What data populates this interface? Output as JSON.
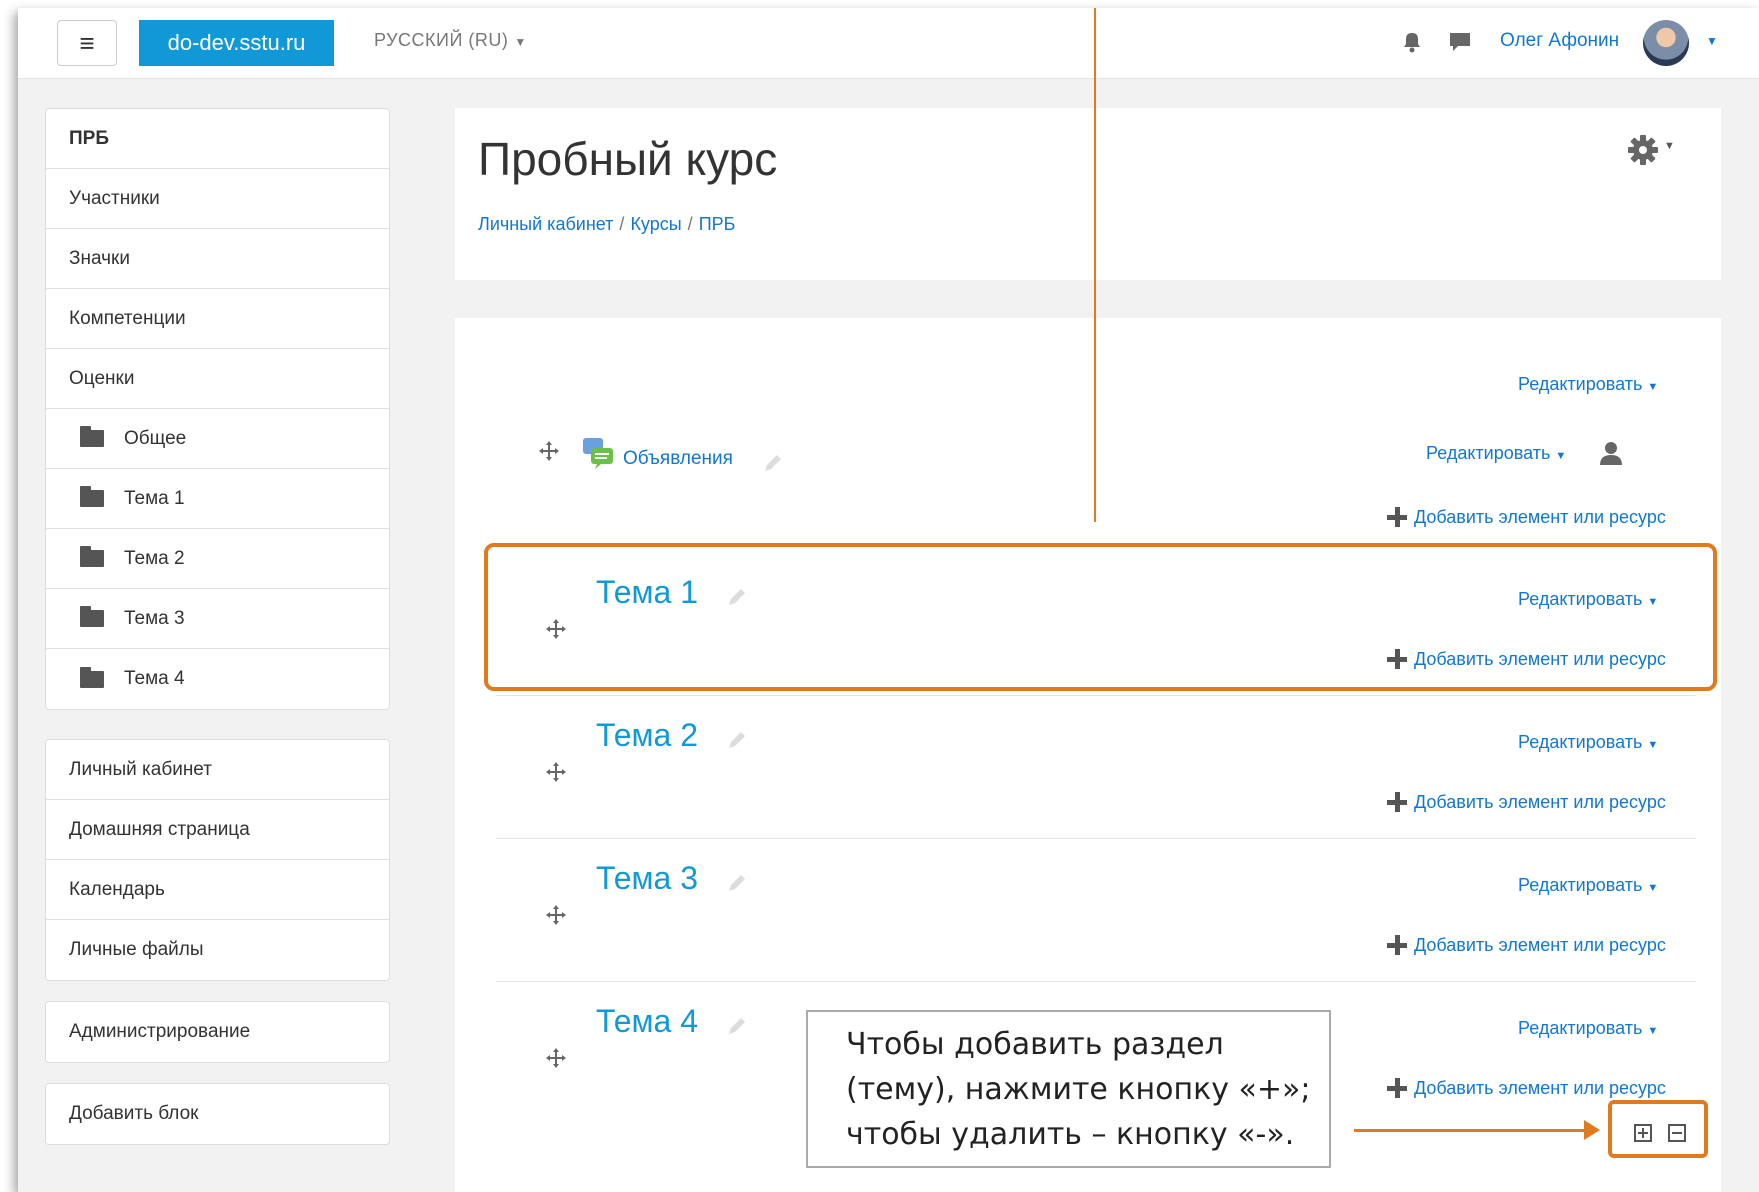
{
  "navbar": {
    "menu_icon": "hamburger-icon",
    "brand": "do-dev.sstu.ru",
    "language": "РУССКИЙ (RU)",
    "user_name": "Олег Афонин",
    "icons": [
      "bell-icon",
      "chat-icon",
      "avatar"
    ]
  },
  "sidebar": {
    "nav": [
      {
        "label": "ПРБ"
      },
      {
        "label": "Участники"
      },
      {
        "label": "Значки"
      },
      {
        "label": "Компетенции"
      },
      {
        "label": "Оценки"
      },
      {
        "label": "Общее"
      },
      {
        "label": "Тема 1"
      },
      {
        "label": "Тема 2"
      },
      {
        "label": "Тема 3"
      },
      {
        "label": "Тема 4"
      }
    ],
    "links": [
      {
        "label": "Личный кабинет"
      },
      {
        "label": "Домашняя страница"
      },
      {
        "label": "Календарь"
      },
      {
        "label": "Личные файлы"
      }
    ],
    "admin": "Администрирование",
    "add_block": "Добавить блок"
  },
  "header": {
    "title": "Пробный курс",
    "breadcrumb": [
      "Личный кабинет",
      "Курсы",
      "ПРБ"
    ],
    "separator": "/"
  },
  "course": {
    "edit_label": "Редактировать",
    "add_label": "Добавить элемент или ресурс",
    "forum": "Объявления",
    "topics": [
      "Тема 1",
      "Тема 2",
      "Тема 3",
      "Тема 4"
    ]
  },
  "annotation": {
    "line1": "Чтобы добавить раздел",
    "line2": "(тему), нажмите кнопку «+»;",
    "line3": "чтобы удалить – кнопку «-».",
    "accent_color": "#e07a1f"
  },
  "colors": {
    "brand": "#1199d7",
    "link": "#1177d1"
  }
}
